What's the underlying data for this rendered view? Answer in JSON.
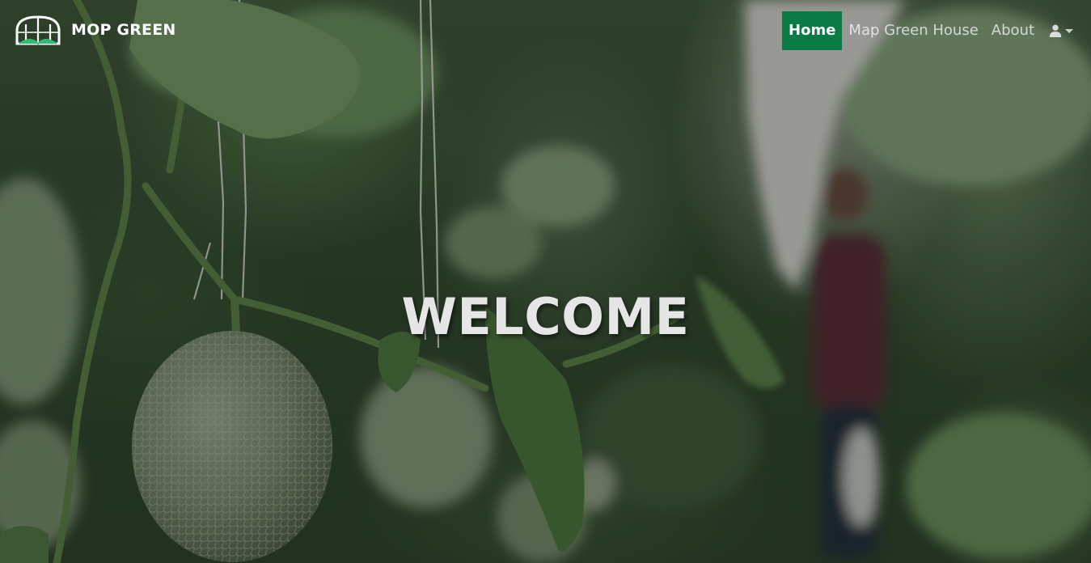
{
  "brand": {
    "name": "MOP GREEN",
    "logo_icon": "greenhouse-icon"
  },
  "nav": {
    "items": [
      {
        "label": "Home",
        "active": true
      },
      {
        "label": "Map Green House",
        "active": false
      },
      {
        "label": "About",
        "active": false
      }
    ],
    "user_icon": "user-icon",
    "user_dropdown_icon": "caret-down-icon"
  },
  "hero": {
    "heading": "WELCOME",
    "background": "greenhouse-melon-photo"
  },
  "colors": {
    "active_nav_bg": "#0c7a45",
    "brand_text": "#ffffff",
    "nav_text": "#d9d9d9",
    "heading_text": "#e6e6e6"
  }
}
